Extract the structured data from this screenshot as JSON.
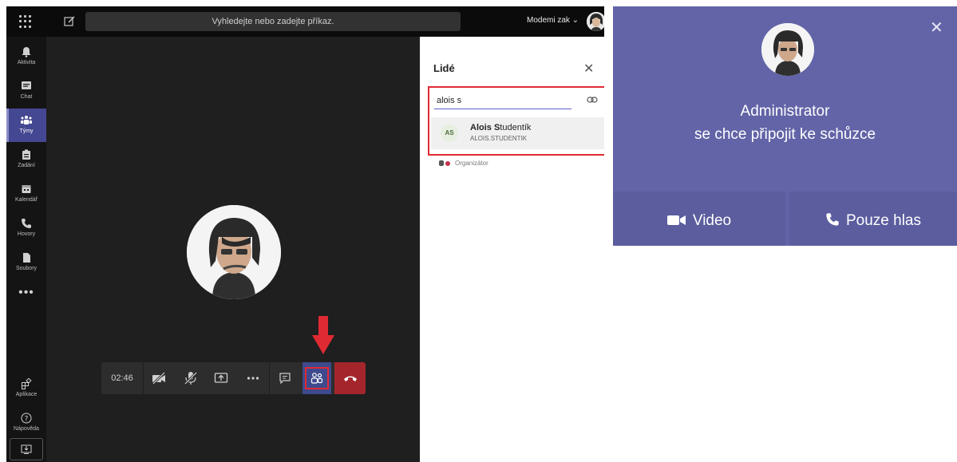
{
  "app": {
    "search_placeholder": "Vyhledejte nebo zadejte příkaz.",
    "account_name": "Modemi zak ⌄"
  },
  "rail": {
    "items": [
      {
        "label": "Aktivita",
        "icon": "bell-icon"
      },
      {
        "label": "Chat",
        "icon": "chat-icon"
      },
      {
        "label": "Týmy",
        "icon": "teams-icon"
      },
      {
        "label": "Zadání",
        "icon": "assignments-icon"
      },
      {
        "label": "Kalendář",
        "icon": "calendar-icon"
      },
      {
        "label": "Hovory",
        "icon": "phone-icon"
      },
      {
        "label": "Soubory",
        "icon": "files-icon"
      }
    ],
    "more": "•••",
    "apps_label": "Aplikace",
    "help_label": "Nápověda"
  },
  "call": {
    "timer": "02:46",
    "controls": [
      "camera-off-icon",
      "mic-off-icon",
      "share-screen-icon",
      "more-icon",
      "chat-icon",
      "participants-icon",
      "hang-up-icon"
    ]
  },
  "panel": {
    "title": "Lidé",
    "search_value": "alois s",
    "suggestion": {
      "initials": "AS",
      "name_match": "Alois S",
      "name_rest": "tudentík",
      "sub": "ALOIS.STUDENTIK"
    },
    "organizer_label": "Organizátor"
  },
  "notification": {
    "name": "Administrator",
    "message": "se chce připojit ke schůzce",
    "video_label": "Video",
    "voice_label": "Pouze hlas",
    "bg": "#6264a7"
  }
}
